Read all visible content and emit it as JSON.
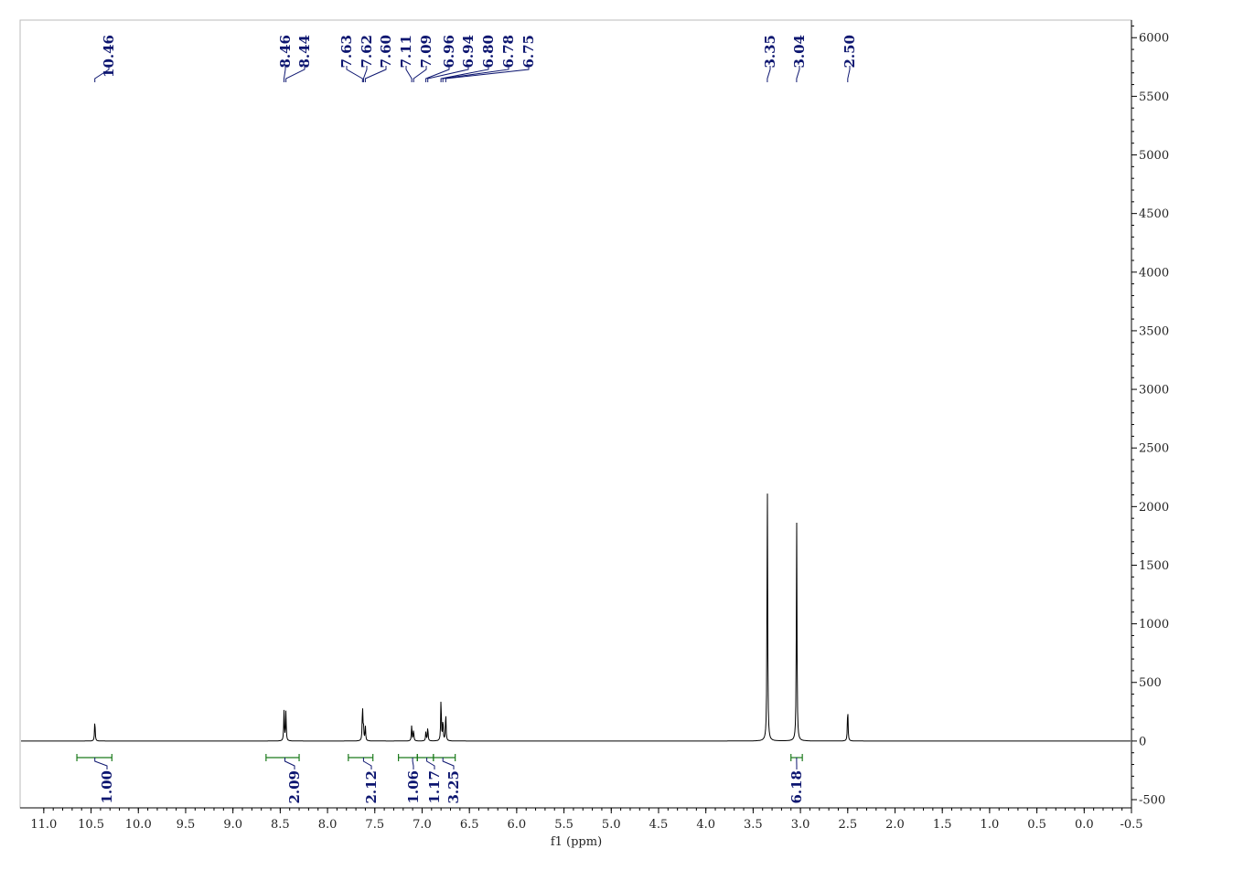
{
  "chart_data": {
    "type": "line",
    "xlabel": "f1 (ppm)",
    "ylabel": "",
    "title": "",
    "xlim": [
      11.25,
      -0.5
    ],
    "ylim": [
      -570,
      6150
    ],
    "x_reversed": true,
    "x_ticks": [
      "11.0",
      "10.5",
      "10.0",
      "9.5",
      "9.0",
      "8.5",
      "8.0",
      "7.5",
      "7.0",
      "6.5",
      "6.0",
      "5.5",
      "5.0",
      "4.5",
      "4.0",
      "3.5",
      "3.0",
      "2.5",
      "2.0",
      "1.5",
      "1.0",
      "0.5",
      "0.0",
      "-0.5"
    ],
    "x_tick_values": [
      11.0,
      10.5,
      10.0,
      9.5,
      9.0,
      8.5,
      8.0,
      7.5,
      7.0,
      6.5,
      6.0,
      5.5,
      5.0,
      4.5,
      4.0,
      3.5,
      3.0,
      2.5,
      2.0,
      1.5,
      1.0,
      0.5,
      0.0,
      -0.5
    ],
    "y_ticks": [
      "6000",
      "5500",
      "5000",
      "4500",
      "4000",
      "3500",
      "3000",
      "2500",
      "2000",
      "1500",
      "1000",
      "500",
      "0",
      "-500"
    ],
    "y_tick_values": [
      6000,
      5500,
      5000,
      4500,
      4000,
      3500,
      3000,
      2500,
      2000,
      1500,
      1000,
      500,
      0,
      -500
    ],
    "y_axis_position": "right",
    "grid": false,
    "peaks": [
      {
        "ppm": 10.46,
        "height": 180
      },
      {
        "ppm": 8.46,
        "height": 255
      },
      {
        "ppm": 8.44,
        "height": 255
      },
      {
        "ppm": 7.63,
        "height": 300
      },
      {
        "ppm": 7.62,
        "height": 120
      },
      {
        "ppm": 7.6,
        "height": 125
      },
      {
        "ppm": 7.11,
        "height": 135
      },
      {
        "ppm": 7.09,
        "height": 95
      },
      {
        "ppm": 6.96,
        "height": 80
      },
      {
        "ppm": 6.94,
        "height": 120
      },
      {
        "ppm": 6.8,
        "height": 370
      },
      {
        "ppm": 6.78,
        "height": 180
      },
      {
        "ppm": 6.75,
        "height": 245
      },
      {
        "ppm": 3.35,
        "height": 2250
      },
      {
        "ppm": 3.04,
        "height": 1890
      },
      {
        "ppm": 2.5,
        "height": 290
      }
    ],
    "peak_labels": [
      "10.46",
      "8.46",
      "8.44",
      "7.63",
      "7.62",
      "7.60",
      "7.11",
      "7.09",
      "6.96",
      "6.94",
      "6.80",
      "6.78",
      "6.75",
      "3.35",
      "3.04",
      "2.50"
    ],
    "integrals": [
      {
        "from": 10.65,
        "to": 10.28,
        "center": 10.46,
        "value": "1.00"
      },
      {
        "from": 8.65,
        "to": 8.3,
        "center": 8.45,
        "value": "2.09"
      },
      {
        "from": 7.78,
        "to": 7.52,
        "center": 7.62,
        "value": "2.12"
      },
      {
        "from": 7.25,
        "to": 7.05,
        "center": 7.1,
        "value": "1.06"
      },
      {
        "from": 7.05,
        "to": 6.88,
        "center": 6.95,
        "value": "1.17"
      },
      {
        "from": 6.88,
        "to": 6.65,
        "center": 6.78,
        "value": "3.25"
      },
      {
        "from": 3.1,
        "to": 2.98,
        "center": 3.04,
        "value": "6.18"
      }
    ]
  },
  "colors": {
    "spectrum": "#000000",
    "peak_label": "#0d1670",
    "integral": "#1b7a1b",
    "axis": "#000000"
  }
}
